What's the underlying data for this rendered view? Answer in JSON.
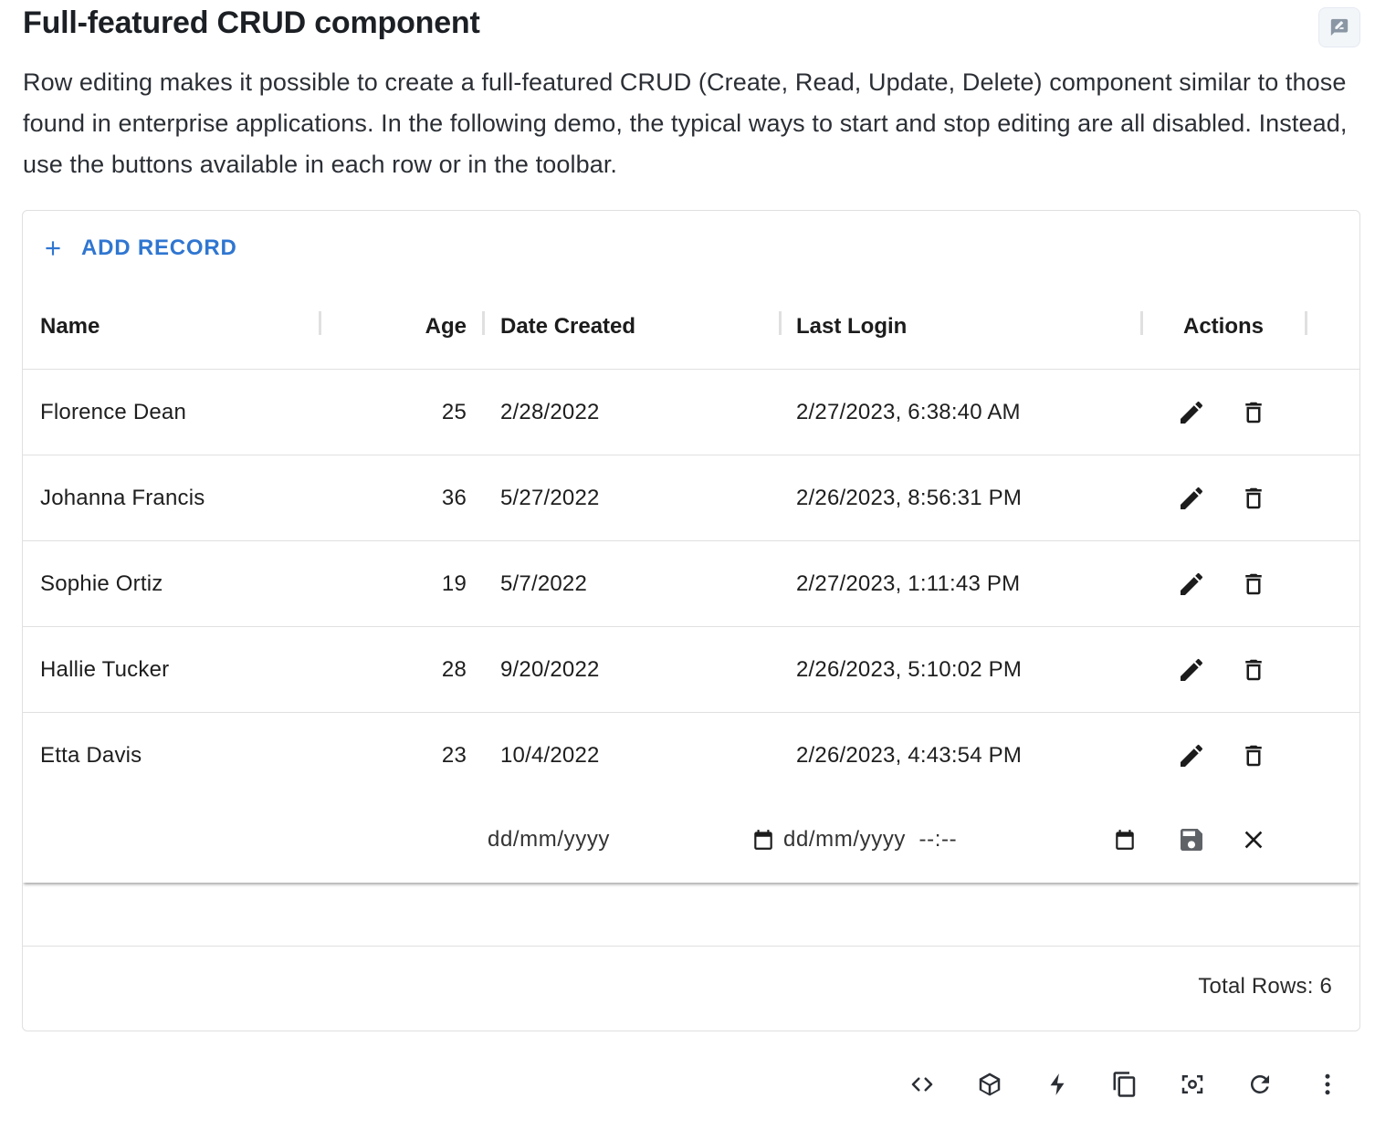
{
  "page": {
    "title": "Full-featured CRUD component",
    "description": "Row editing makes it possible to create a full-featured CRUD (Create, Read, Update, Delete) component similar to those found in enterprise applications. In the following demo, the typical ways to start and stop editing are all disabled. Instead, use the buttons available in each row or in the toolbar."
  },
  "toolbar": {
    "add_label": "ADD RECORD"
  },
  "columns": [
    "Name",
    "Age",
    "Date Created",
    "Last Login",
    "Actions"
  ],
  "rows": [
    {
      "name": "Florence Dean",
      "age": "25",
      "created": "2/28/2022",
      "last_login": "2/27/2023, 6:38:40 AM"
    },
    {
      "name": "Johanna Francis",
      "age": "36",
      "created": "5/27/2022",
      "last_login": "2/26/2023, 8:56:31 PM"
    },
    {
      "name": "Sophie Ortiz",
      "age": "19",
      "created": "5/7/2022",
      "last_login": "2/27/2023, 1:11:43 PM"
    },
    {
      "name": "Hallie Tucker",
      "age": "28",
      "created": "9/20/2022",
      "last_login": "2/26/2023, 5:10:02 PM"
    },
    {
      "name": "Etta Davis",
      "age": "23",
      "created": "10/4/2022",
      "last_login": "2/26/2023, 4:43:54 PM"
    }
  ],
  "edit_row": {
    "date_placeholder": "dd/mm/yyyy",
    "datetime_placeholder": "dd/mm/yyyy  --:--"
  },
  "footer": {
    "total_rows": "Total Rows: 6"
  },
  "colors": {
    "accent": "#2f76d1",
    "border": "#e0e0e0",
    "icon": "#1c1c1c"
  },
  "icons": {
    "toolbar": [
      "add-icon"
    ],
    "row_actions": [
      "edit-icon",
      "delete-icon"
    ],
    "edit_actions": [
      "save-icon",
      "cancel-icon"
    ],
    "bottom_tools": [
      "code-icon",
      "codesandbox-icon",
      "stackblitz-icon",
      "copy-icon",
      "reset-focus-icon",
      "reset-icon",
      "more-icon"
    ]
  }
}
